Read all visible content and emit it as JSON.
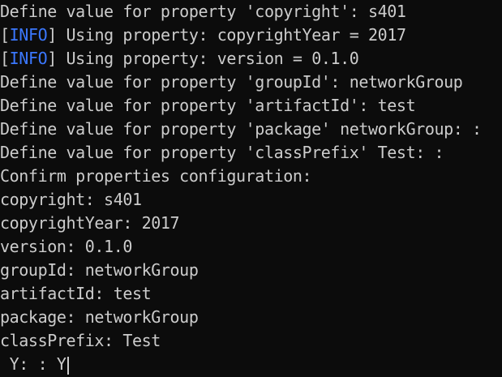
{
  "colors": {
    "background": "#0c0c0c",
    "text": "#cccccc",
    "info_tag": "#3b78ff"
  },
  "lines": [
    {
      "text": "Define value for property 'copyright': s401"
    },
    {
      "tag": "INFO",
      "text": " Using property: copyrightYear = 2017"
    },
    {
      "tag": "INFO",
      "text": " Using property: version = 0.1.0"
    },
    {
      "text": "Define value for property 'groupId': networkGroup"
    },
    {
      "text": "Define value for property 'artifactId': test"
    },
    {
      "text": "Define value for property 'package' networkGroup: :"
    },
    {
      "text": "Define value for property 'classPrefix' Test: :"
    },
    {
      "text": "Confirm properties configuration:"
    },
    {
      "text": "copyright: s401"
    },
    {
      "text": "copyrightYear: 2017"
    },
    {
      "text": "version: 0.1.0"
    },
    {
      "text": "groupId: networkGroup"
    },
    {
      "text": "artifactId: test"
    },
    {
      "text": "package: networkGroup"
    },
    {
      "text": "classPrefix: Test"
    }
  ],
  "prompt": {
    "text": " Y: : Y"
  }
}
